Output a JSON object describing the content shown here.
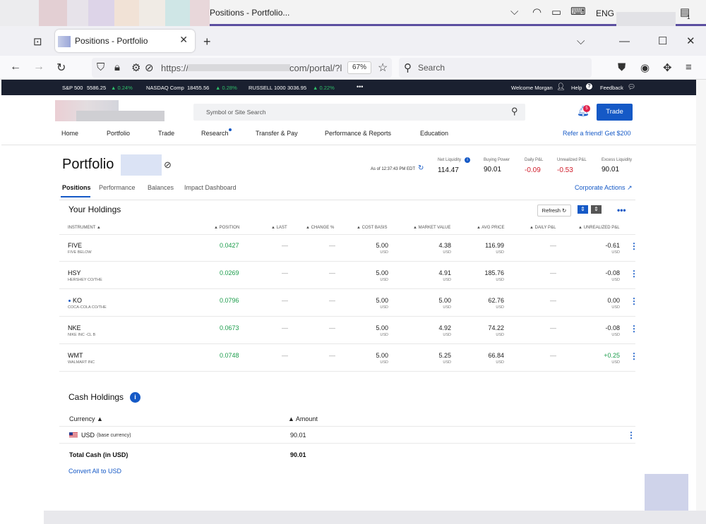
{
  "taskbar": {
    "window_title": "Positions - Portfolio...",
    "language": "ENG",
    "notifications": "1"
  },
  "browser": {
    "tab_title": "Positions - Portfolio",
    "url_prefix": "https://",
    "url_suffix": "com/portal/?l",
    "zoom": "67%",
    "search_placeholder": "Search"
  },
  "ticker": {
    "items": [
      {
        "name": "S&P 500",
        "value": "5586.25",
        "change": "▲ 0.24%"
      },
      {
        "name": "NASDAQ Comp",
        "value": "18455.56",
        "change": "▲ 0.28%"
      },
      {
        "name": "RUSSELL 1000",
        "value": "3036.95",
        "change": "▲ 0.22%"
      }
    ],
    "more": "•••",
    "welcome": "Welcome Morgan",
    "help": "Help",
    "feedback": "Feedback"
  },
  "header": {
    "search_placeholder": "Symbol or Site Search",
    "bell_count": "5",
    "trade_label": "Trade",
    "menu": [
      "Home",
      "Portfolio",
      "Trade",
      "Research",
      "Transfer & Pay",
      "Performance & Reports",
      "Education"
    ],
    "refer": "Refer a friend! Get $200"
  },
  "portfolio": {
    "title": "Portfolio",
    "tabs": [
      "Positions",
      "Performance",
      "Balances",
      "Impact Dashboard"
    ],
    "as_of": "As of 12:37:43 PM EDT",
    "corporate_actions": "Corporate Actions ↗",
    "stats": [
      {
        "label": "Net Liquidity",
        "value": "114.47"
      },
      {
        "label": "Buying Power",
        "value": "90.01"
      },
      {
        "label": "Daily P&L",
        "value": "-0.09"
      },
      {
        "label": "Unrealized P&L",
        "value": "-0.53"
      },
      {
        "label": "Excess Liquidity",
        "value": "90.01"
      }
    ]
  },
  "holdings": {
    "title": "Your Holdings",
    "refresh": "Refresh",
    "columns": [
      "INSTRUMENT ▲",
      "▲ POSITION",
      "▲ LAST",
      "▲ CHANGE %",
      "▲ COST BASIS",
      "▲ MARKET VALUE",
      "▲ AVG PRICE",
      "▲ DAILY P&L",
      "▲ UNREALIZED P&L"
    ],
    "rows": [
      {
        "symbol": "FIVE",
        "desc": "FIVE BELOW",
        "position": "0.0427",
        "last": "—",
        "change": "—",
        "cost": "5.00",
        "market": "4.38",
        "avg": "116.99",
        "daily": "—",
        "unreal": "-0.61",
        "unit": "USD"
      },
      {
        "symbol": "HSY",
        "desc": "HERSHEY CO/THE",
        "position": "0.0269",
        "last": "—",
        "change": "—",
        "cost": "5.00",
        "market": "4.91",
        "avg": "185.76",
        "daily": "—",
        "unreal": "-0.08",
        "unit": "USD"
      },
      {
        "symbol": "KO",
        "desc": "COCA-COLA CO/THE",
        "position": "0.0796",
        "last": "—",
        "change": "—",
        "cost": "5.00",
        "market": "5.00",
        "avg": "62.76",
        "daily": "—",
        "unreal": "0.00",
        "unit": "USD"
      },
      {
        "symbol": "NKE",
        "desc": "NIKE INC -CL B",
        "position": "0.0673",
        "last": "—",
        "change": "—",
        "cost": "5.00",
        "market": "4.92",
        "avg": "74.22",
        "daily": "—",
        "unreal": "-0.08",
        "unit": "USD"
      },
      {
        "symbol": "WMT",
        "desc": "WALMART INC",
        "position": "0.0748",
        "last": "—",
        "change": "—",
        "cost": "5.00",
        "market": "5.25",
        "avg": "66.84",
        "daily": "—",
        "unreal": "+0.25",
        "unit": "USD"
      }
    ]
  },
  "cash": {
    "title": "Cash Holdings",
    "col_currency": "Currency ▲",
    "col_amount": "▲ Amount",
    "currency": "USD",
    "currency_note": "(base currency)",
    "amount": "90.01",
    "total_label": "Total Cash (in USD)",
    "total_value": "90.01",
    "convert": "Convert All to USD"
  }
}
